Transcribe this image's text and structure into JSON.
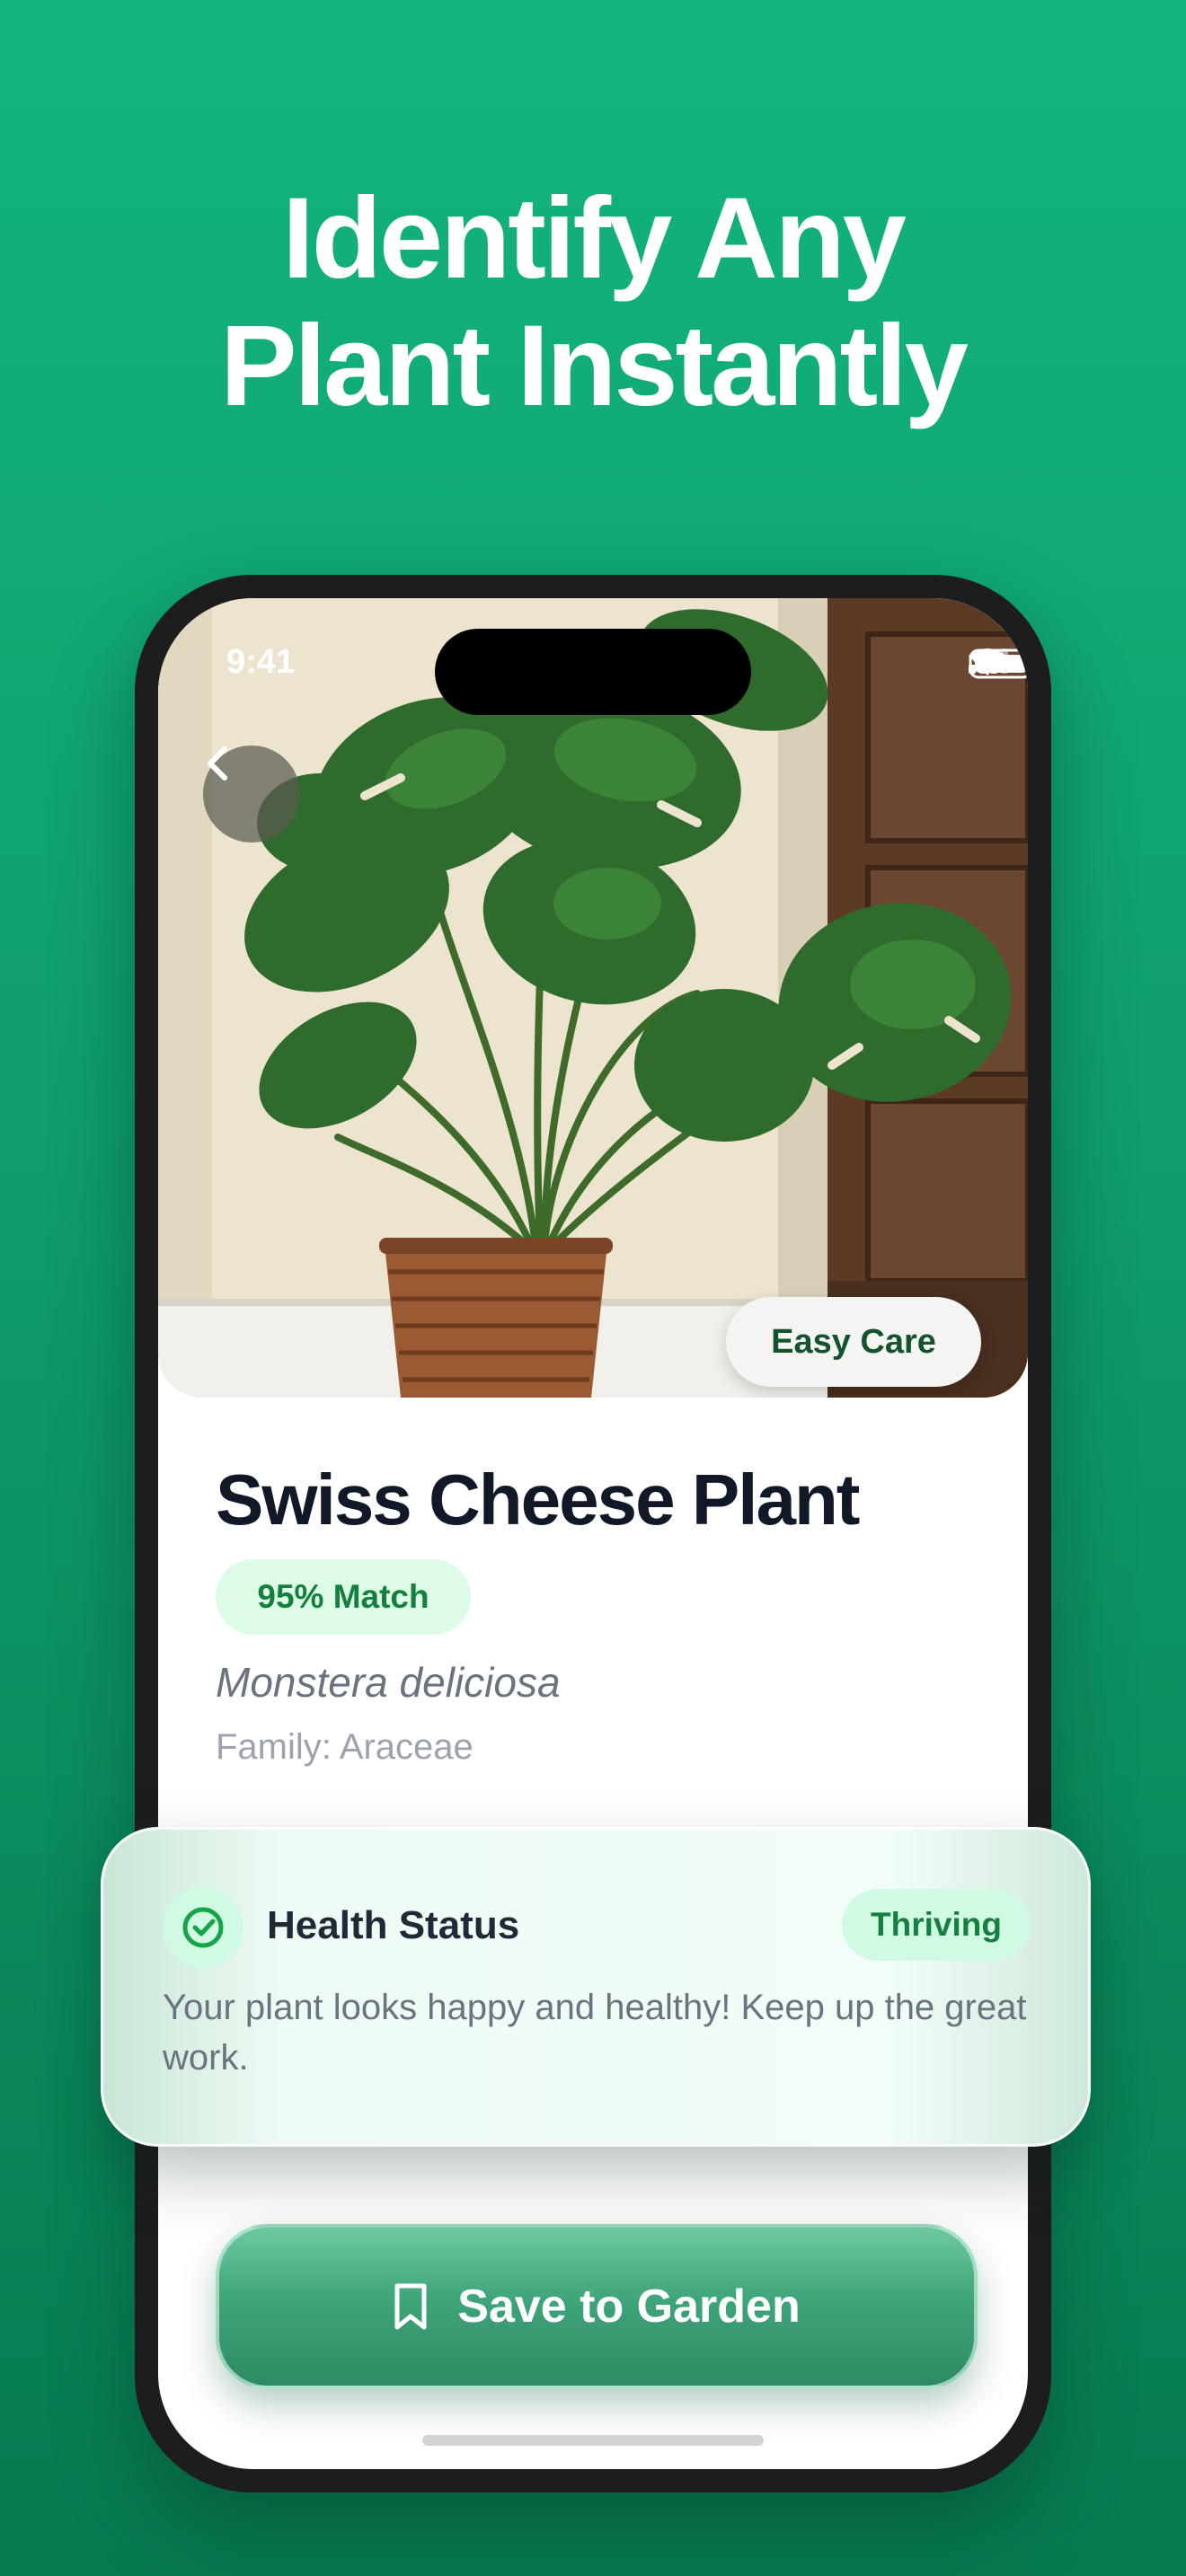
{
  "headline": {
    "line1": "Identify Any",
    "line2": "Plant Instantly"
  },
  "status_bar": {
    "time": "9:41"
  },
  "photo": {
    "care_chip": "Easy Care"
  },
  "plant": {
    "common_name": "Swiss Cheese Plant",
    "match": "95% Match",
    "scientific_name": "Monstera deliciosa",
    "family": "Family: Araceae"
  },
  "health": {
    "title": "Health Status",
    "badge": "Thriving",
    "description": "Your plant looks happy and healthy! Keep up the great work."
  },
  "actions": {
    "save_label": "Save to Garden"
  },
  "colors": {
    "brand_green": "#13b57c",
    "accent_text": "#15803d",
    "badge_bg": "#dcfce7"
  },
  "icons": [
    "chevron-left-icon",
    "signal-icon",
    "wifi-icon",
    "battery-icon",
    "check-circle-icon",
    "bookmark-icon"
  ]
}
